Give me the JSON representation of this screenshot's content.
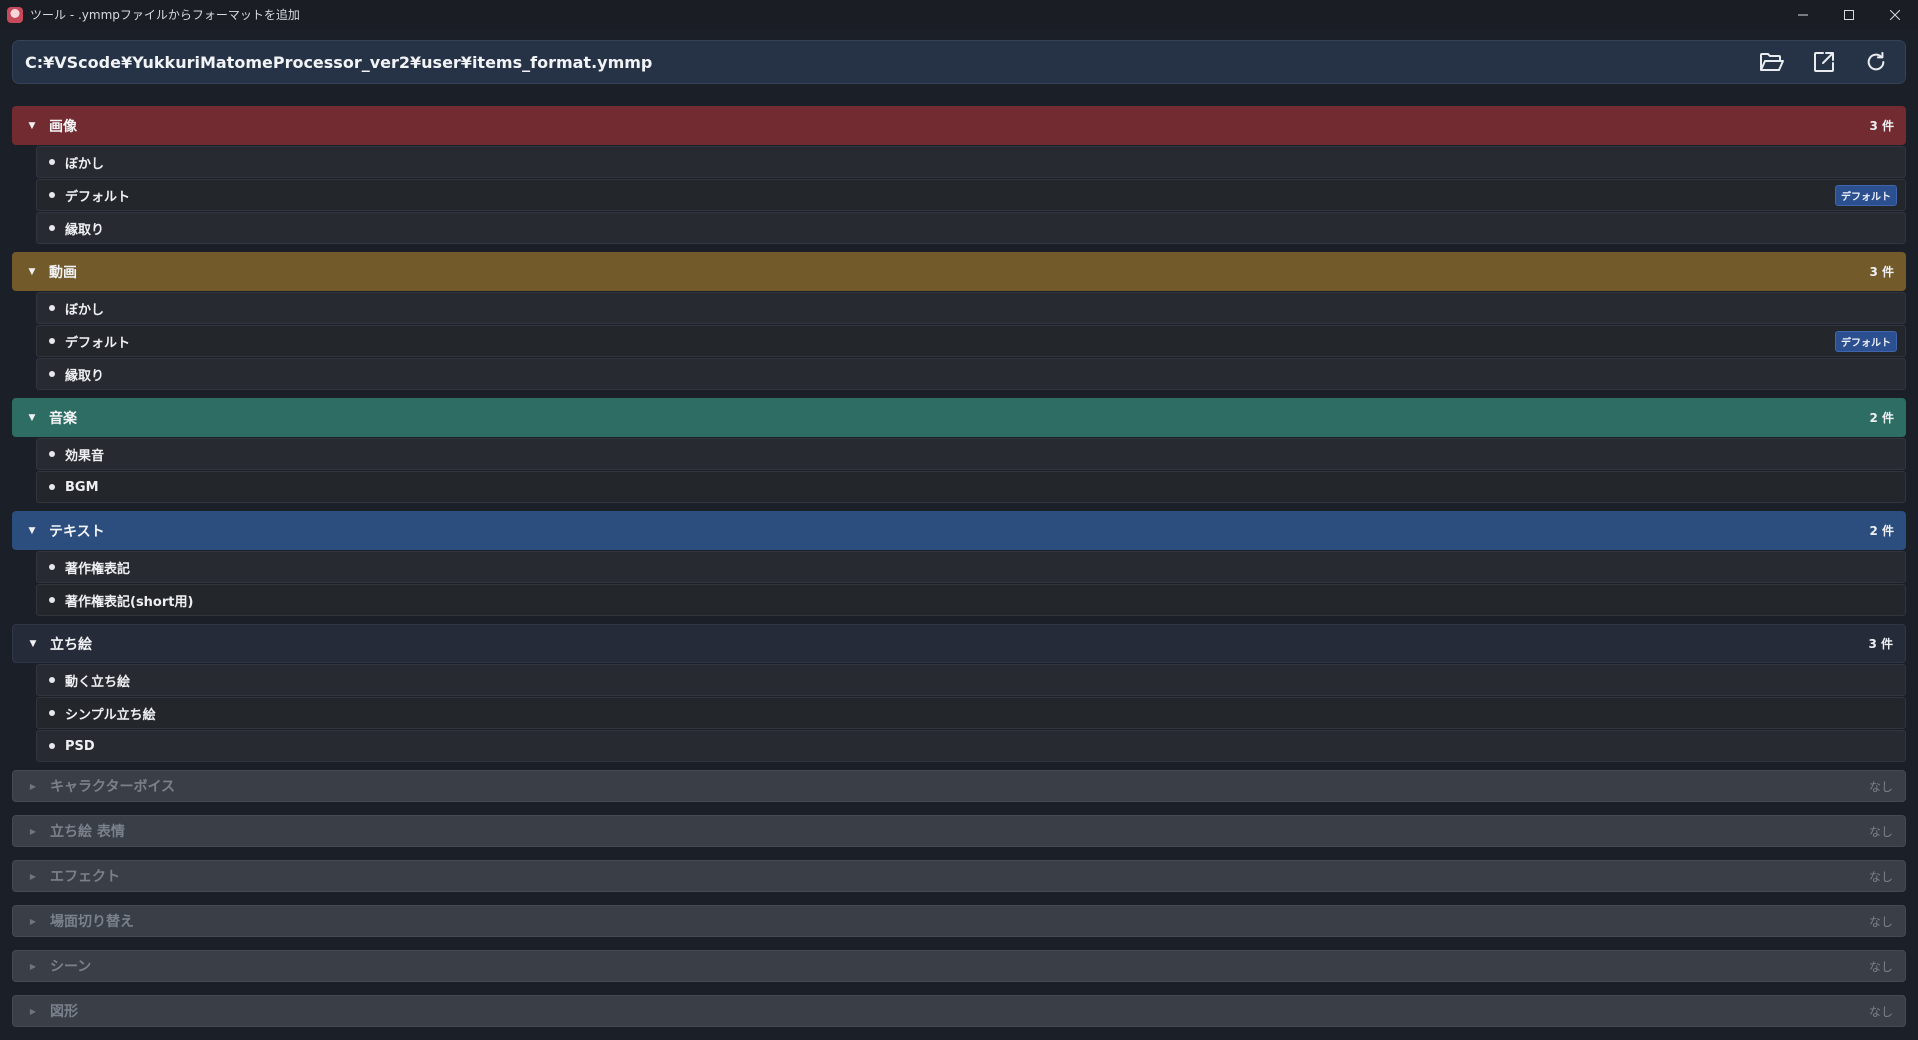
{
  "window": {
    "title": "ツール - .ymmpファイルからフォーマットを追加",
    "minimize": "—",
    "maximize": "☐",
    "close": "✕"
  },
  "pathbar": {
    "path": "C:¥VScode¥YukkuriMatomeProcessor_ver2¥user¥items_format.ymmp",
    "icons": [
      "folder-open-icon",
      "open-external-icon",
      "refresh-icon"
    ]
  },
  "colors": {
    "image": "#722b30",
    "video": "#735a2b",
    "music": "#2d6d64",
    "text": "#2b4e7f",
    "tachie": "#252b38",
    "badge": "#2c4f8f"
  },
  "categories": [
    {
      "label": "画像",
      "count": "3 件",
      "expanded": true,
      "color": "#722b30",
      "items": [
        {
          "label": "ぼかし",
          "badge": ""
        },
        {
          "label": "デフォルト",
          "badge": "デフォルト"
        },
        {
          "label": "縁取り",
          "badge": ""
        }
      ]
    },
    {
      "label": "動画",
      "count": "3 件",
      "expanded": true,
      "color": "#735a2b",
      "items": [
        {
          "label": "ぼかし",
          "badge": ""
        },
        {
          "label": "デフォルト",
          "badge": "デフォルト"
        },
        {
          "label": "縁取り",
          "badge": ""
        }
      ]
    },
    {
      "label": "音楽",
      "count": "2 件",
      "expanded": true,
      "color": "#2d6d64",
      "items": [
        {
          "label": "効果音",
          "badge": ""
        },
        {
          "label": "BGM",
          "badge": ""
        }
      ]
    },
    {
      "label": "テキスト",
      "count": "2 件",
      "expanded": true,
      "color": "#2b4e7f",
      "items": [
        {
          "label": "著作権表記",
          "badge": ""
        },
        {
          "label": "著作権表記(short用)",
          "badge": ""
        }
      ]
    },
    {
      "label": "立ち絵",
      "count": "3 件",
      "expanded": true,
      "color": "#252b38",
      "items": [
        {
          "label": "動く立ち絵",
          "badge": ""
        },
        {
          "label": "シンプル立ち絵",
          "badge": ""
        },
        {
          "label": "PSD",
          "badge": ""
        }
      ]
    },
    {
      "label": "キャラクターボイス",
      "count": "なし",
      "expanded": false,
      "items": []
    },
    {
      "label": "立ち絵 表情",
      "count": "なし",
      "expanded": false,
      "items": []
    },
    {
      "label": "エフェクト",
      "count": "なし",
      "expanded": false,
      "items": []
    },
    {
      "label": "場面切り替え",
      "count": "なし",
      "expanded": false,
      "items": []
    },
    {
      "label": "シーン",
      "count": "なし",
      "expanded": false,
      "items": []
    },
    {
      "label": "図形",
      "count": "なし",
      "expanded": false,
      "items": []
    }
  ]
}
